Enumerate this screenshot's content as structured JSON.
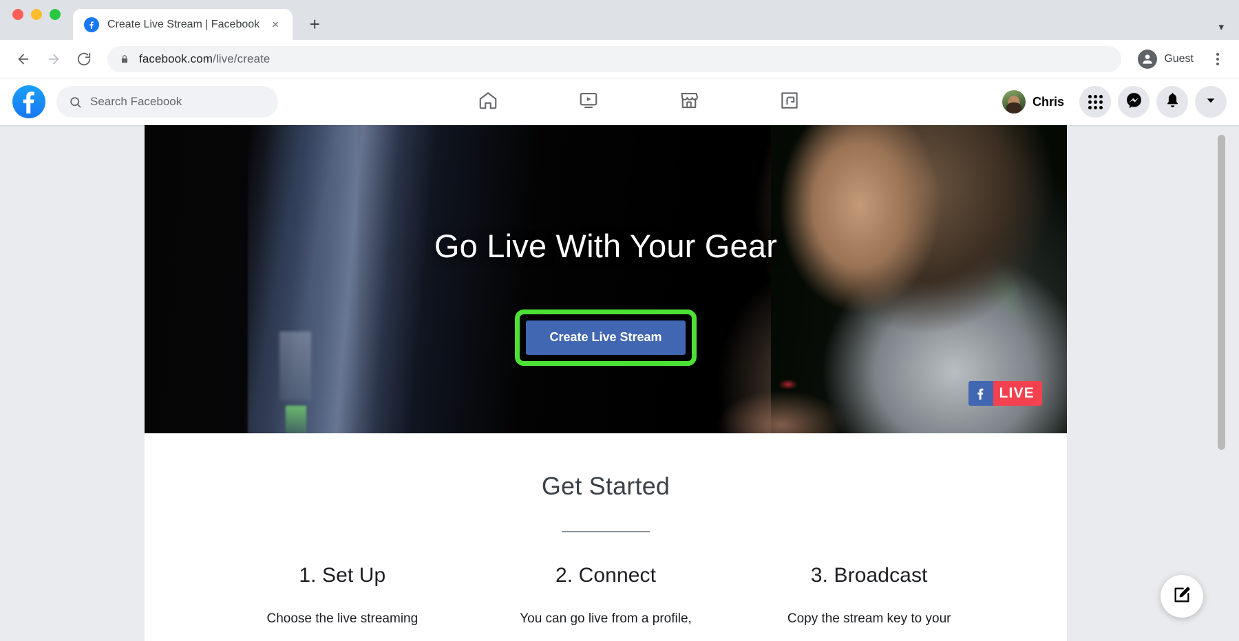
{
  "browser": {
    "tab": {
      "title": "Create Live Stream | Facebook",
      "favicon": "facebook-icon",
      "close_label": "×"
    },
    "new_tab_label": "+",
    "tab_list_chevron": "▾",
    "toolbar": {
      "back_label": "back-arrow",
      "forward_label": "forward-arrow",
      "reload_label": "reload",
      "lock_label": "lock-icon",
      "url_domain": "facebook.com",
      "url_path": "/live/create",
      "profile_name": "Guest"
    }
  },
  "fb_header": {
    "logo_label": "facebook-logo",
    "search_placeholder": "Search Facebook",
    "nav": [
      {
        "name": "home",
        "label": "Home"
      },
      {
        "name": "watch",
        "label": "Watch"
      },
      {
        "name": "marketplace",
        "label": "Marketplace"
      },
      {
        "name": "gaming",
        "label": "Gaming"
      }
    ],
    "profile_name": "Chris",
    "actions": [
      {
        "name": "menu-grid",
        "label": "Menu"
      },
      {
        "name": "messenger",
        "label": "Messenger"
      },
      {
        "name": "notifications",
        "label": "Notifications"
      },
      {
        "name": "account",
        "label": "Account"
      }
    ]
  },
  "hero": {
    "title": "Go Live With Your Gear",
    "cta_label": "Create Live Stream",
    "highlight_color": "#4de035",
    "cta_color": "#4267b2",
    "badge": {
      "f_label": "f",
      "live_label": "LIVE",
      "live_color": "#f4414f",
      "f_color": "#4267b2"
    }
  },
  "get_started": {
    "title": "Get Started",
    "steps": [
      {
        "title": "1. Set Up",
        "desc": "Choose the live streaming"
      },
      {
        "title": "2. Connect",
        "desc": "You can go live from a profile,"
      },
      {
        "title": "3. Broadcast",
        "desc": "Copy the stream key to your"
      }
    ]
  },
  "fab": {
    "label": "compose"
  }
}
